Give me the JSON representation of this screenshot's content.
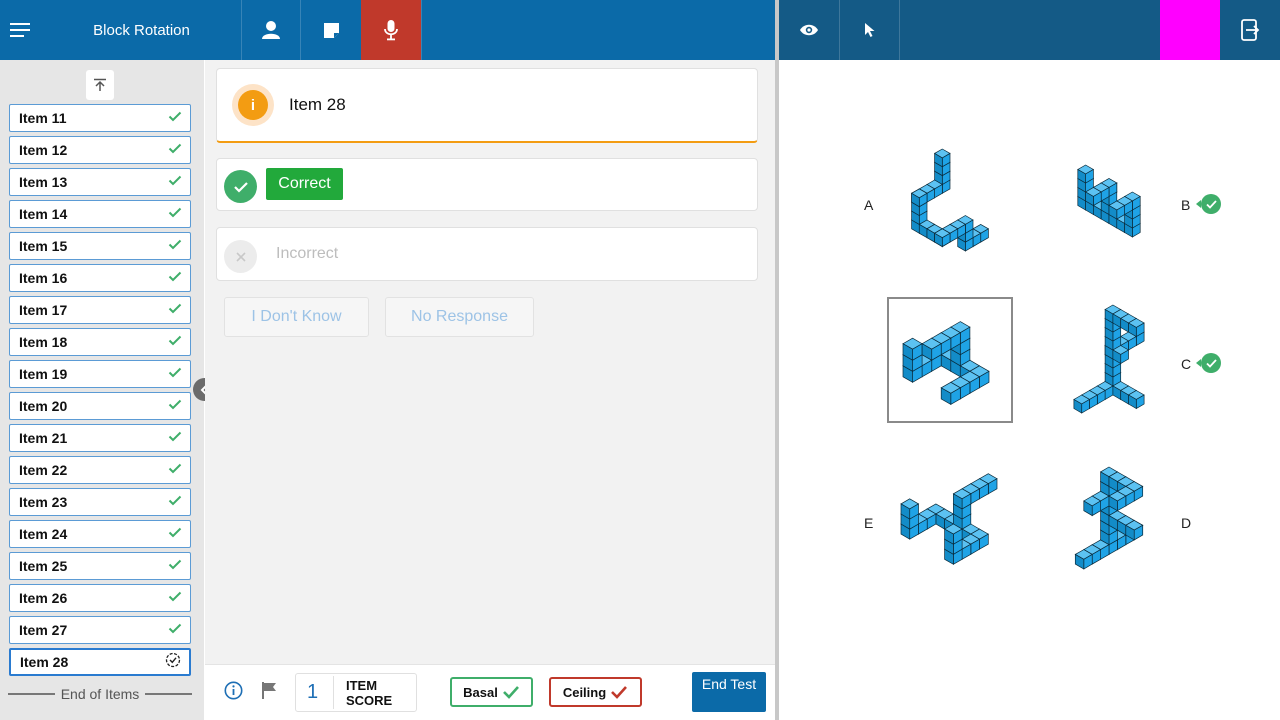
{
  "header": {
    "title": "Block Rotation"
  },
  "sidebar": {
    "items": [
      {
        "label": "Item 11",
        "status": "done"
      },
      {
        "label": "Item 12",
        "status": "done"
      },
      {
        "label": "Item 13",
        "status": "done"
      },
      {
        "label": "Item 14",
        "status": "done"
      },
      {
        "label": "Item 15",
        "status": "done"
      },
      {
        "label": "Item 16",
        "status": "done"
      },
      {
        "label": "Item 17",
        "status": "done"
      },
      {
        "label": "Item 18",
        "status": "done"
      },
      {
        "label": "Item 19",
        "status": "done"
      },
      {
        "label": "Item 20",
        "status": "done"
      },
      {
        "label": "Item 21",
        "status": "done"
      },
      {
        "label": "Item 22",
        "status": "done"
      },
      {
        "label": "Item 23",
        "status": "done"
      },
      {
        "label": "Item 24",
        "status": "done"
      },
      {
        "label": "Item 25",
        "status": "done"
      },
      {
        "label": "Item 26",
        "status": "done"
      },
      {
        "label": "Item 27",
        "status": "done"
      },
      {
        "label": "Item 28",
        "status": "pending"
      }
    ],
    "end_label": "End of Items"
  },
  "main": {
    "item_title": "Item 28",
    "info_glyph": "i",
    "correct_label": "Correct",
    "incorrect_label": "Incorrect",
    "dont_know_label": "I Don't Know",
    "no_response_label": "No Response"
  },
  "footer": {
    "item_score_value": "1",
    "item_score_label": "ITEM SCORE",
    "basal_label": "Basal",
    "ceiling_label": "Ceiling",
    "end_test_label": "End Test"
  },
  "stimulus": {
    "options": [
      {
        "label": "A"
      },
      {
        "label": "B",
        "marked_correct": true
      },
      {
        "label": "C",
        "marked_correct": true
      },
      {
        "label": "D"
      },
      {
        "label": "E"
      }
    ]
  },
  "colors": {
    "topbar": "#0b6aa8",
    "topbar_right": "#145a86",
    "mic_active": "#c0392b",
    "correct_green": "#22a93b",
    "check_green": "#3fae6a",
    "info_orange": "#f39c12",
    "cube_blue": "#1fa3e6",
    "magenta": "#ff00ff"
  }
}
